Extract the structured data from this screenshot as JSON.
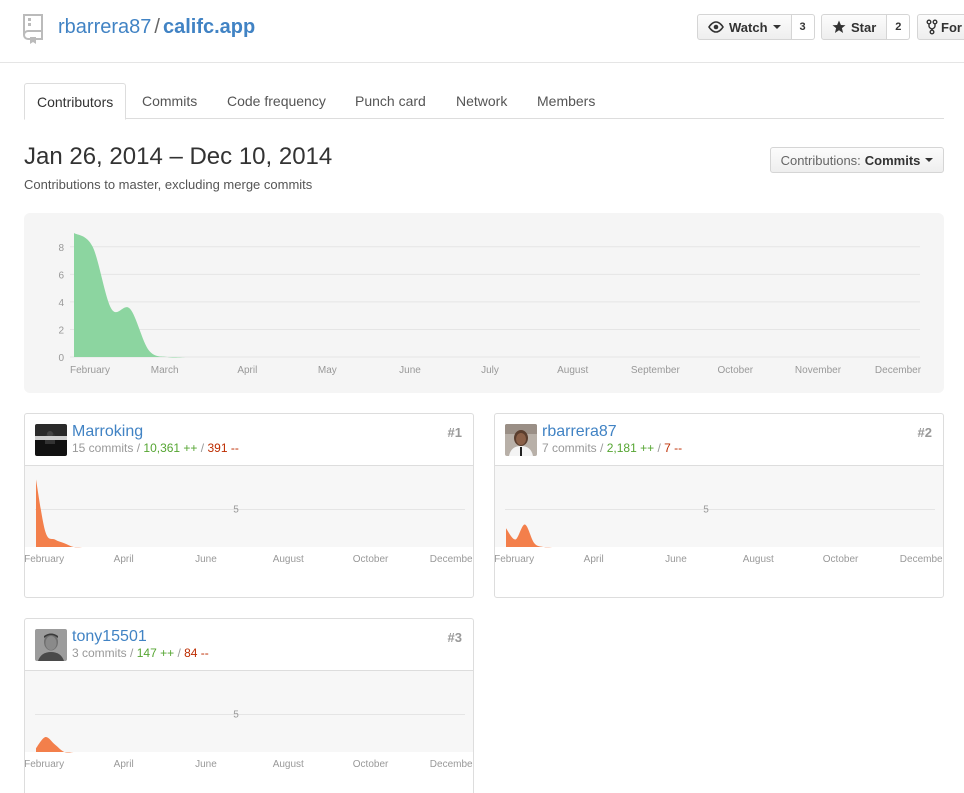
{
  "repo": {
    "owner": "rbarrera87",
    "separator": "/",
    "name": "califc.app"
  },
  "actions": {
    "watch": {
      "label": "Watch",
      "count": "3"
    },
    "star": {
      "label": "Star",
      "count": "2"
    },
    "fork": {
      "label": "For"
    }
  },
  "tabs": [
    "Contributors",
    "Commits",
    "Code frequency",
    "Punch card",
    "Network",
    "Members"
  ],
  "selected_tab": "Contributors",
  "range": {
    "title": "Jan 26, 2014 – Dec 10, 2014",
    "subtitle": "Contributions to master, excluding merge commits"
  },
  "contributions_select": {
    "label": "Contributions:",
    "value": "Commits"
  },
  "chart_data": [
    {
      "type": "area",
      "x_labels": [
        "February",
        "March",
        "April",
        "May",
        "June",
        "July",
        "August",
        "September",
        "October",
        "November",
        "December"
      ],
      "y_ticks": [
        0,
        2,
        4,
        6,
        8
      ],
      "ylim": [
        0,
        9
      ],
      "color": "#8cd5a0",
      "weeks": [
        "2014-01-26",
        "2014-02-02",
        "2014-02-09",
        "2014-02-16",
        "2014-02-23",
        "2014-03-02",
        "2014-03-09"
      ],
      "values": [
        9,
        8,
        3.5,
        3.5,
        0.5,
        0,
        0
      ]
    },
    {
      "type": "area",
      "contributor": "Marroking",
      "x_labels": [
        "February",
        "April",
        "June",
        "August",
        "October",
        "December"
      ],
      "y_ticks": [
        5
      ],
      "ylim": [
        0,
        10
      ],
      "color": "#f37f4b",
      "weeks": [
        "2014-01-26",
        "2014-02-02",
        "2014-02-09",
        "2014-02-16",
        "2014-02-23",
        "2014-03-02"
      ],
      "values": [
        9,
        2,
        1,
        0.5,
        0,
        0
      ]
    },
    {
      "type": "area",
      "contributor": "rbarrera87",
      "x_labels": [
        "February",
        "April",
        "June",
        "August",
        "October",
        "December"
      ],
      "y_ticks": [
        5
      ],
      "ylim": [
        0,
        10
      ],
      "color": "#f37f4b",
      "weeks": [
        "2014-01-26",
        "2014-02-02",
        "2014-02-09",
        "2014-02-16",
        "2014-02-23",
        "2014-03-02"
      ],
      "values": [
        2.5,
        1,
        3,
        0.5,
        0,
        0
      ]
    },
    {
      "type": "area",
      "contributor": "tony15501",
      "x_labels": [
        "February",
        "April",
        "June",
        "August",
        "October",
        "December"
      ],
      "y_ticks": [
        5
      ],
      "ylim": [
        0,
        10
      ],
      "color": "#f37f4b",
      "weeks": [
        "2014-01-26",
        "2014-02-02",
        "2014-02-09",
        "2014-02-16",
        "2014-02-23"
      ],
      "values": [
        0.5,
        2,
        1,
        0,
        0
      ]
    }
  ],
  "contributors": [
    {
      "name": "Marroking",
      "commits": "15 commits",
      "sep": "/",
      "additions": "10,361 ++",
      "deletions": "391 --",
      "rank": "#1"
    },
    {
      "name": "rbarrera87",
      "commits": "7 commits",
      "sep": "/",
      "additions": "2,181 ++",
      "deletions": "7 --",
      "rank": "#2"
    },
    {
      "name": "tony15501",
      "commits": "3 commits",
      "sep": "/",
      "additions": "147 ++",
      "deletions": "84 --",
      "rank": "#3"
    }
  ]
}
